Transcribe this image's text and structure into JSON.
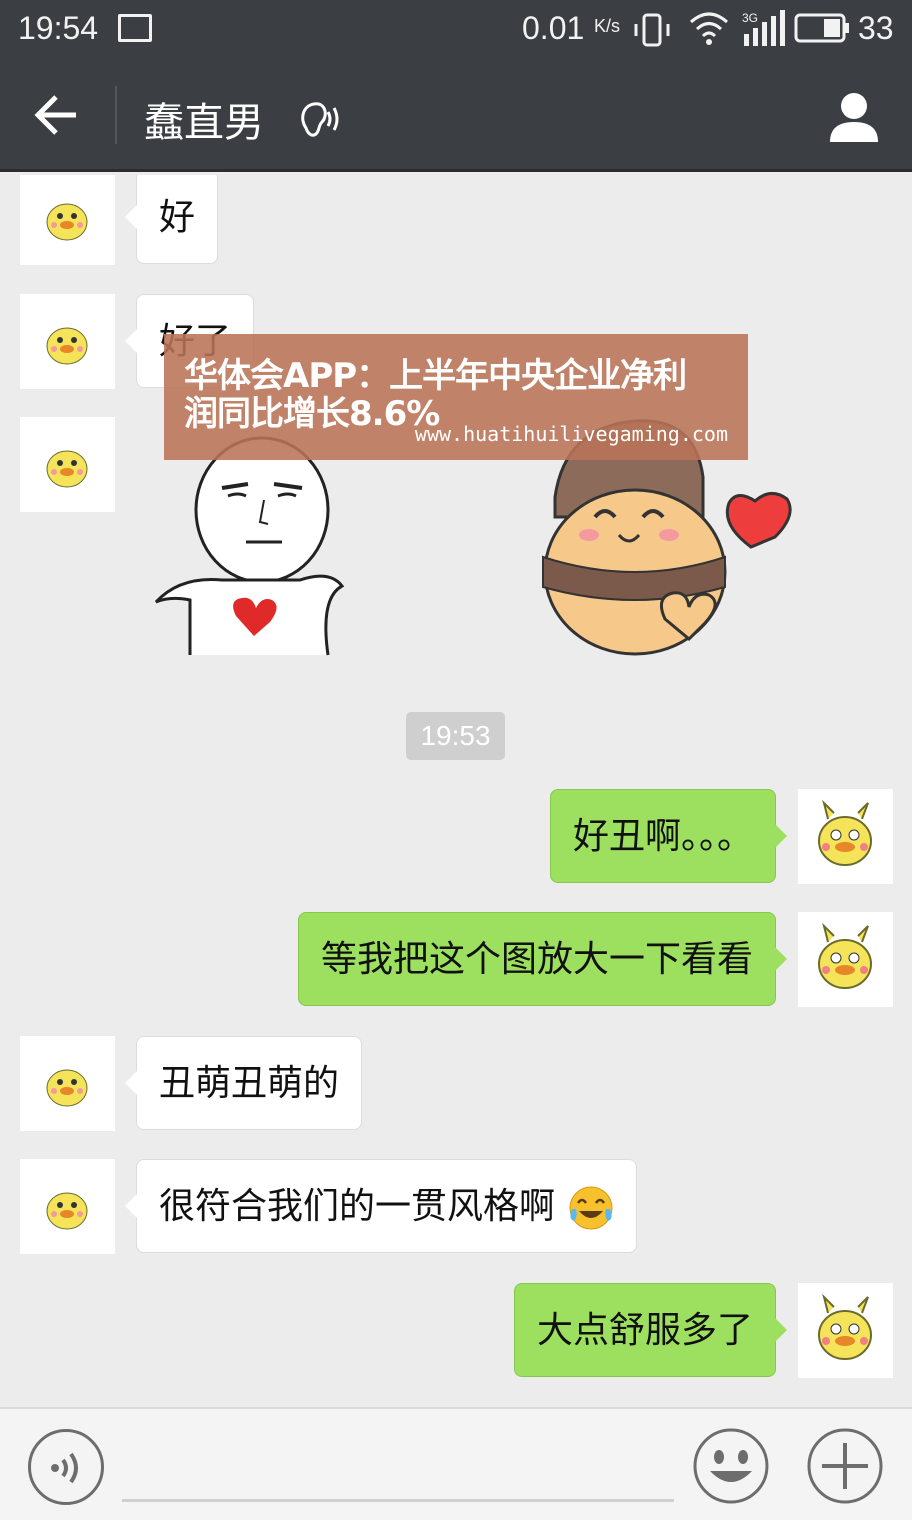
{
  "status_bar": {
    "time": "19:54",
    "network_speed": "0.01",
    "network_speed_unit": "K/s",
    "signal_label": "3G",
    "battery_percent": "33",
    "icons": [
      "image-icon",
      "vibrate-icon",
      "wifi-icon",
      "signal-icon",
      "battery-icon"
    ]
  },
  "header": {
    "title": "蠢直男",
    "icons": [
      "back-arrow-icon",
      "earpiece-icon",
      "contact-profile-icon"
    ]
  },
  "chat": {
    "messages": [
      {
        "side": "incoming",
        "type": "text",
        "text": "好"
      },
      {
        "side": "incoming",
        "type": "text",
        "text": "好了"
      },
      {
        "side": "incoming",
        "type": "stickers",
        "stickers": [
          "rage-face-heart-sticker",
          "hat-bear-heart-sticker"
        ]
      },
      {
        "side": "outgoing",
        "type": "text",
        "text": "好丑啊。。。"
      },
      {
        "side": "outgoing",
        "type": "text",
        "text": "等我把这个图放大一下看看"
      },
      {
        "side": "incoming",
        "type": "text",
        "text": "丑萌丑萌的"
      },
      {
        "side": "incoming",
        "type": "text",
        "text": "很符合我们的一贯风格啊",
        "emoji": "laughing-crying-emoji"
      },
      {
        "side": "outgoing",
        "type": "text",
        "text": "大点舒服多了"
      }
    ],
    "timestamp": "19:53"
  },
  "watermark": {
    "line1": "华体会APP：上半年中央企业净利",
    "line2": "润同比增长8.6%",
    "url": "www.huatihuilivegaming.com"
  },
  "input_bar": {
    "icons": [
      "voice-icon",
      "emoji-icon",
      "plus-icon"
    ]
  },
  "colors": {
    "header_bg": "#3b3e42",
    "chat_bg": "#ececec",
    "outgoing_bubble": "#9de05f",
    "incoming_bubble": "#ffffff",
    "watermark_bg": "#b97458"
  }
}
